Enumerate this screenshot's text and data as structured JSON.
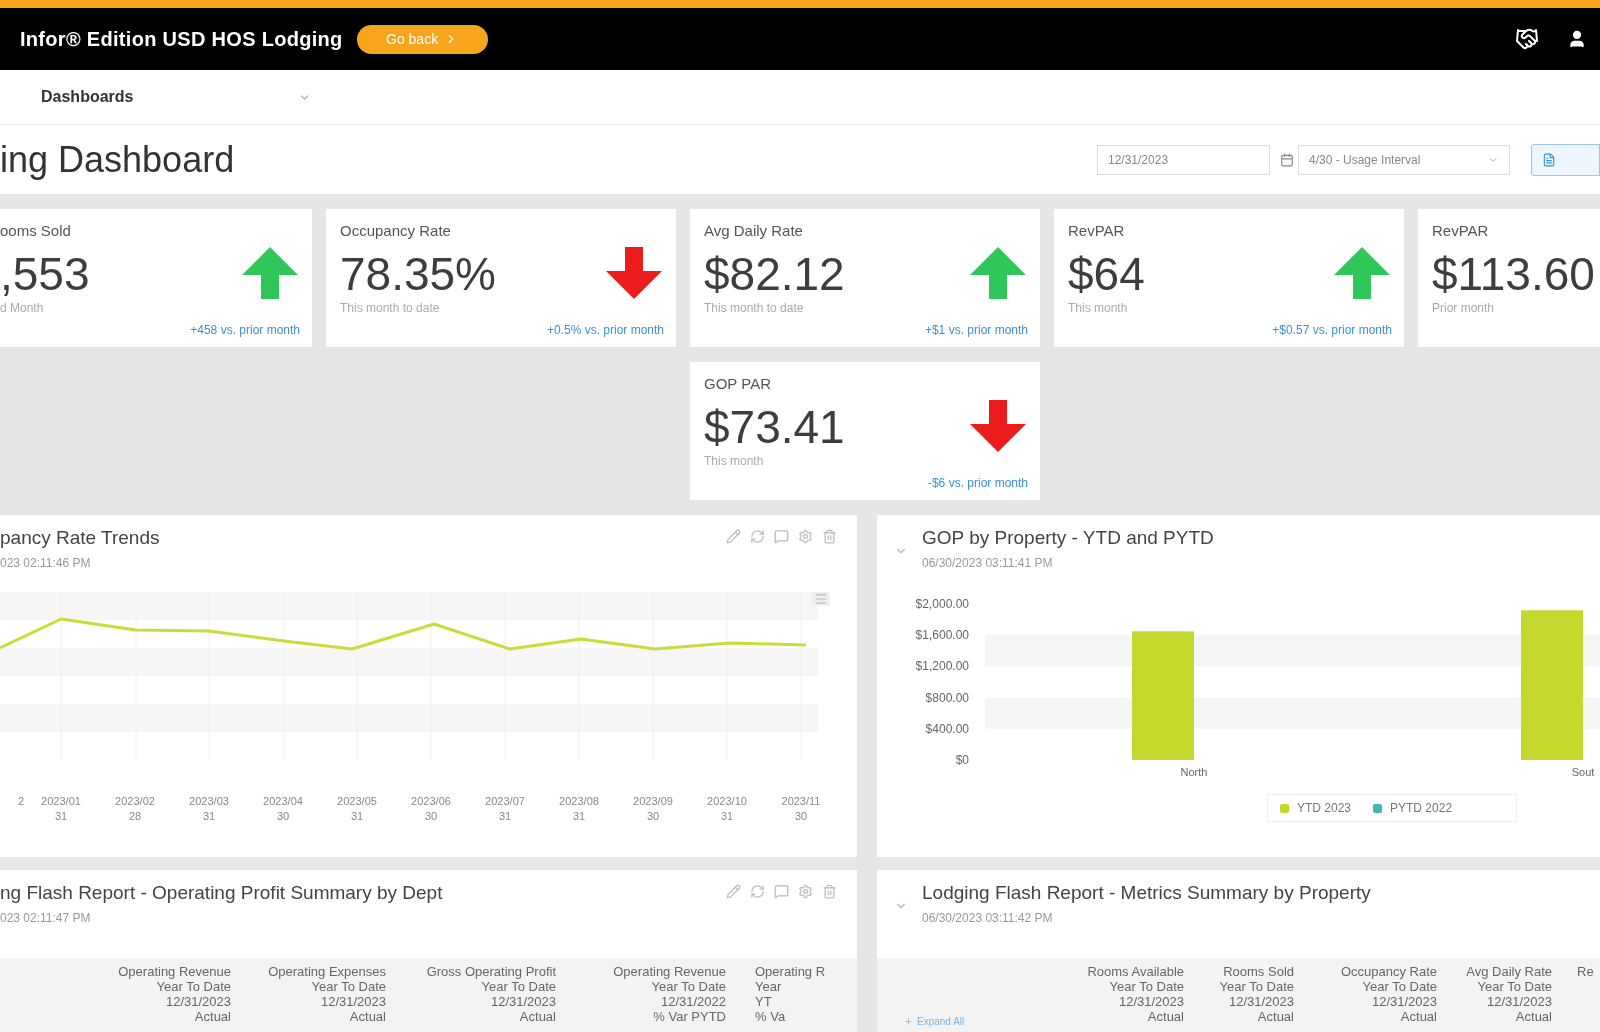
{
  "header": {
    "title": "Infor® Edition USD HOS Lodging",
    "badge": "Go back"
  },
  "nav": {
    "label": "Dashboards"
  },
  "page": {
    "title": "ing Dashboard",
    "date": "12/31/2023",
    "interval": "4/30 - Usage Interval"
  },
  "kpis": [
    {
      "title": "ooms Sold",
      "value": ",553",
      "subtitle": "d Month",
      "rising": true,
      "link": "+458 vs. prior month"
    },
    {
      "title": "Occupancy Rate",
      "value": "78.35%",
      "subtitle": "This month to date",
      "rising": false,
      "link": "+0.5% vs. prior month"
    },
    {
      "title": "Avg Daily Rate",
      "value": "$82.12",
      "subtitle": "This month to date",
      "rising": true,
      "link": "+$1 vs. prior month"
    },
    {
      "title": "RevPAR",
      "value": "$64",
      "subtitle": "This month",
      "rising": true,
      "link": "+$0.57 vs. prior month"
    },
    {
      "title": "RevPAR",
      "value": "$113.60",
      "subtitle": "Prior month"
    },
    {
      "title": "GOP PAR",
      "value": "$73.41",
      "subtitle": "This month",
      "rising": false,
      "link": "-$6 vs. prior month"
    }
  ],
  "panels": [
    {
      "kind": "line_chart",
      "title": "pancy Rate Trends",
      "subtitle": "023 02:11:46 PM",
      "toolbar": true,
      "collapsible": false,
      "x_labels": [
        {
          "line1": "2"
        },
        {
          "line1": "2023/01",
          "line2": "31"
        },
        {
          "line1": "2023/02",
          "line2": "28"
        },
        {
          "line1": "2023/03",
          "line2": "31"
        },
        {
          "line1": "2023/04",
          "line2": "30"
        },
        {
          "line1": "2023/05",
          "line2": "31"
        },
        {
          "line1": "2023/06",
          "line2": "30"
        },
        {
          "line1": "2023/07",
          "line2": "31"
        },
        {
          "line1": "2023/08",
          "line2": "31"
        },
        {
          "line1": "2023/09",
          "line2": "30"
        },
        {
          "line1": "2023/10",
          "line2": "31"
        },
        {
          "line1": "2023/11",
          "line2": "30"
        }
      ]
    },
    {
      "kind": "bar_chart",
      "title": "GOP by Property - YTD and PYTD",
      "subtitle": "06/30/2023 03:11:41 PM",
      "toolbar": false,
      "collapsible": true,
      "chart_data": {
        "type": "bar",
        "categories": [
          "North",
          "Sout"
        ],
        "series": [
          {
            "name": "YTD 2023",
            "color": "#c5d82e",
            "values": [
              1650,
              1920
            ]
          },
          {
            "name": "PYTD 2022",
            "color": "#3fb8af",
            "values": [
              0,
              0
            ]
          }
        ],
        "ylim": [
          0,
          2000
        ],
        "yticks": [
          {
            "value": 2000,
            "label": "$2,000.00"
          },
          {
            "value": 1600,
            "label": "$1,600.00"
          },
          {
            "value": 1200,
            "label": "$1,200.00"
          },
          {
            "value": 800,
            "label": "$800.00"
          },
          {
            "value": 400,
            "label": "$400.00"
          },
          {
            "value": 0,
            "label": "$0"
          }
        ]
      }
    },
    {
      "kind": "table",
      "title": "ng Flash Report - Operating Profit Summary by Dept",
      "subtitle": "023 02:11:47 PM",
      "toolbar": true,
      "collapsible": false,
      "columns": [
        {
          "lines": [
            "Operating Revenue",
            "Year To Date",
            "12/31/2023",
            "Actual"
          ]
        },
        {
          "lines": [
            "Operating Expenses",
            "Year To Date",
            "12/31/2023",
            "Actual"
          ]
        },
        {
          "lines": [
            "Gross Operating Profit",
            "Year To Date",
            "12/31/2023",
            "Actual"
          ]
        },
        {
          "lines": [
            "Operating Revenue",
            "Year To Date",
            "12/31/2022",
            "% Var PYTD"
          ]
        },
        {
          "lines": [
            "Operating R",
            "Year",
            "YT",
            "% Va"
          ]
        }
      ]
    },
    {
      "kind": "table",
      "title": "Lodging Flash Report - Metrics Summary by Property",
      "subtitle": "06/30/2023 03:11:42 PM",
      "toolbar": false,
      "collapsible": true,
      "columns": [
        {
          "lines": [
            "Rooms Available",
            "Year To Date",
            "12/31/2023",
            "Actual"
          ]
        },
        {
          "lines": [
            "Rooms Sold",
            "Year To Date",
            "12/31/2023",
            "Actual"
          ]
        },
        {
          "lines": [
            "Occupancy Rate",
            "Year To Date",
            "12/31/2023",
            "Actual"
          ]
        },
        {
          "lines": [
            "Avg Daily Rate",
            "Year To Date",
            "12/31/2023",
            "Actual"
          ]
        },
        {
          "lines": [
            "Re"
          ]
        }
      ],
      "link": "Expand All"
    }
  ]
}
